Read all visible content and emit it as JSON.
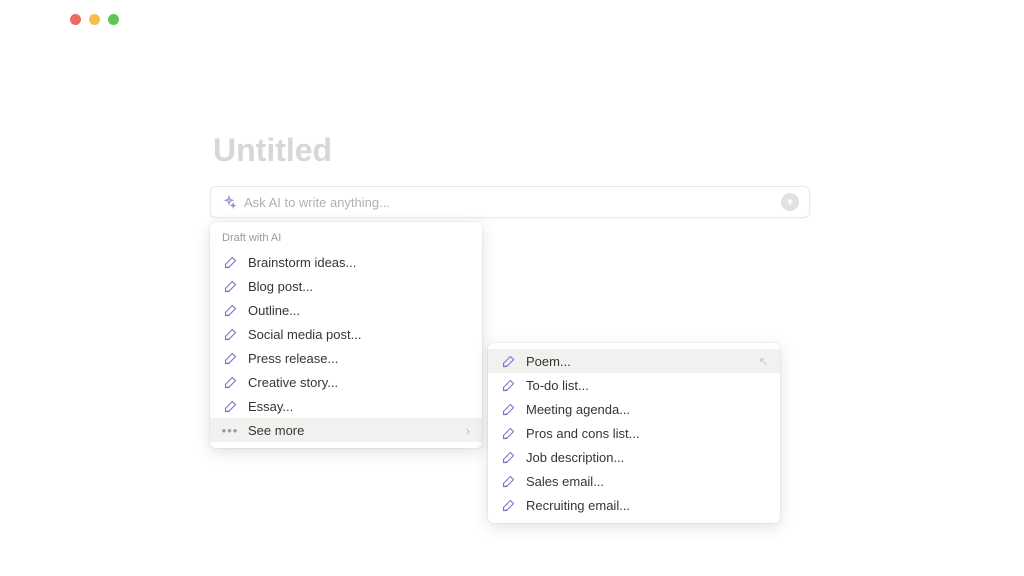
{
  "page": {
    "title": "Untitled"
  },
  "ai_input": {
    "placeholder": "Ask AI to write anything..."
  },
  "menu_a": {
    "header": "Draft with AI",
    "items": [
      {
        "label": "Brainstorm ideas..."
      },
      {
        "label": "Blog post..."
      },
      {
        "label": "Outline..."
      },
      {
        "label": "Social media post..."
      },
      {
        "label": "Press release..."
      },
      {
        "label": "Creative story..."
      },
      {
        "label": "Essay..."
      }
    ],
    "see_more": "See more"
  },
  "menu_b": {
    "items": [
      {
        "label": "Poem..."
      },
      {
        "label": "To-do list..."
      },
      {
        "label": "Meeting agenda..."
      },
      {
        "label": "Pros and cons list..."
      },
      {
        "label": "Job description..."
      },
      {
        "label": "Sales email..."
      },
      {
        "label": "Recruiting email..."
      }
    ]
  },
  "colors": {
    "accent": "#8a6fc7"
  }
}
